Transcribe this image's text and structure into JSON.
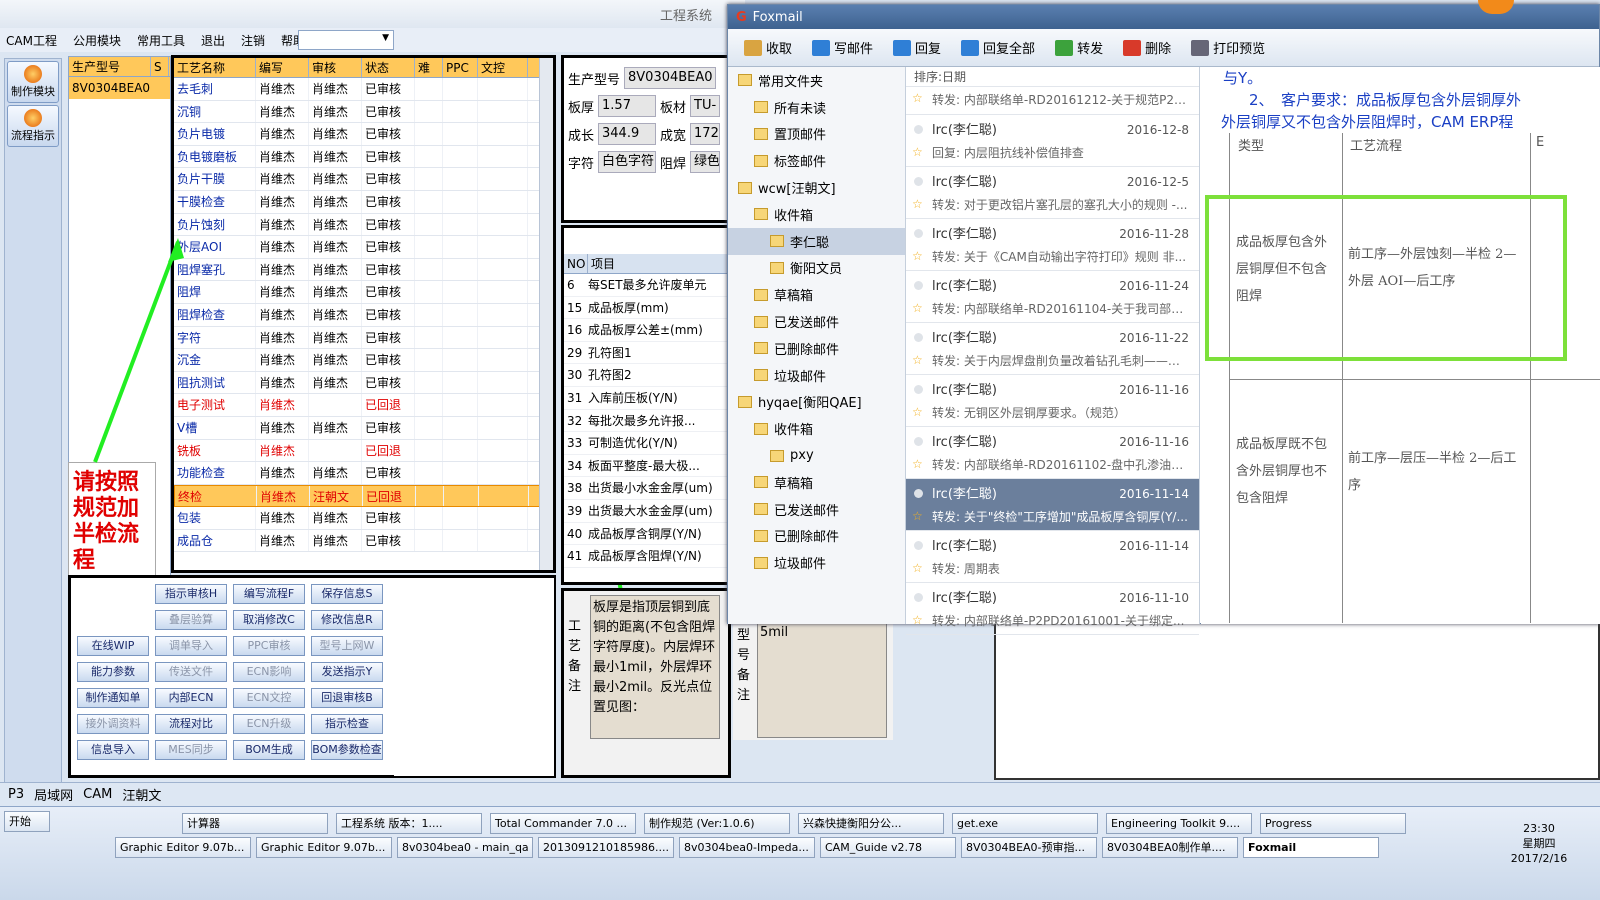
{
  "app": {
    "title": "工程系统",
    "menu": [
      "CAM工程",
      "公用模块",
      "常用工具",
      "退出",
      "注销",
      "帮助"
    ],
    "nav": [
      "制作模块",
      "流程指示"
    ]
  },
  "left_grid": {
    "headers": [
      "生产型号",
      "S"
    ],
    "value": "8V0304BEA0"
  },
  "process": {
    "headers": [
      "工艺名称",
      "编写",
      "审核",
      "状态",
      "难",
      "PPC",
      "文控"
    ],
    "rows": [
      [
        "去毛刺",
        "肖维杰",
        "肖维杰",
        "已审核"
      ],
      [
        "沉铜",
        "肖维杰",
        "肖维杰",
        "已审核"
      ],
      [
        "负片电镀",
        "肖维杰",
        "肖维杰",
        "已审核"
      ],
      [
        "负电镀磨板",
        "肖维杰",
        "肖维杰",
        "已审核"
      ],
      [
        "负片干膜",
        "肖维杰",
        "肖维杰",
        "已审核"
      ],
      [
        "干膜检查",
        "肖维杰",
        "肖维杰",
        "已审核"
      ],
      [
        "负片蚀刻",
        "肖维杰",
        "肖维杰",
        "已审核"
      ],
      [
        "外层AOI",
        "肖维杰",
        "肖维杰",
        "已审核"
      ],
      [
        "阻焊塞孔",
        "肖维杰",
        "肖维杰",
        "已审核"
      ],
      [
        "阻焊",
        "肖维杰",
        "肖维杰",
        "已审核"
      ],
      [
        "阻焊检查",
        "肖维杰",
        "肖维杰",
        "已审核"
      ],
      [
        "字符",
        "肖维杰",
        "肖维杰",
        "已审核"
      ],
      [
        "沉金",
        "肖维杰",
        "肖维杰",
        "已审核"
      ],
      [
        "阻抗测试",
        "肖维杰",
        "肖维杰",
        "已审核"
      ],
      [
        "电子测试",
        "肖维杰",
        "",
        "已回退"
      ],
      [
        "V槽",
        "肖维杰",
        "肖维杰",
        "已审核"
      ],
      [
        "铣板",
        "肖维杰",
        "",
        "已回退"
      ],
      [
        "功能检查",
        "肖维杰",
        "肖维杰",
        "已审核"
      ],
      [
        "终检",
        "肖维杰",
        "汪朝文",
        "已回退"
      ],
      [
        "包装",
        "肖维杰",
        "肖维杰",
        "已审核"
      ],
      [
        "成品仓",
        "肖维杰",
        "肖维杰",
        "已审核"
      ]
    ]
  },
  "note": "请按照规范加半检流程",
  "buttons": [
    [
      "指示审核H",
      "编写流程F",
      "保存信息S"
    ],
    [
      "叠层验算",
      "取消修改C",
      "修改信息R"
    ],
    [
      "在线WIP",
      "调单导入",
      "PPC审核",
      "型号上网W"
    ],
    [
      "能力参数",
      "传送文件",
      "ECN影响",
      "发送指示Y"
    ],
    [
      "制作通知单",
      "内部ECN",
      "ECN文控",
      "回退审核B"
    ],
    [
      "接外调资料",
      "流程对比",
      "ECN升级",
      "指示检查"
    ],
    [
      "信息导入",
      "MES同步",
      "BOM生成",
      "BOM参数检查"
    ]
  ],
  "info": {
    "model_label": "生产型号",
    "model": "8V0304BEA0",
    "thick_label": "板厚",
    "thick": "1.57",
    "mat_label": "板材",
    "mat": "TU-",
    "len_label": "成长",
    "len": "344.9",
    "wid_label": "成宽",
    "wid": "172",
    "char_label": "字符",
    "char": "白色字符",
    "mask_label": "阻焊",
    "mask": "绿色"
  },
  "params": {
    "headers": [
      "NO",
      "项目"
    ],
    "rows": [
      [
        "6",
        "每SET最多允许废单元"
      ],
      [
        "15",
        "成品板厚(mm)"
      ],
      [
        "16",
        "成品板厚公差±(mm)"
      ],
      [
        "29",
        "孔符图1"
      ],
      [
        "30",
        "孔符图2"
      ],
      [
        "31",
        "入库前压板(Y/N)"
      ],
      [
        "32",
        "每批次最多允许报..."
      ],
      [
        "33",
        "可制造优化(Y/N)"
      ],
      [
        "34",
        "板面平整度-最大极..."
      ],
      [
        "38",
        "出货最小水金金厚(um)"
      ],
      [
        "39",
        "出货最大水金金厚(um)"
      ],
      [
        "40",
        "成品板厚含铜厚(Y/N)"
      ],
      [
        "41",
        "成品板厚含阻焊(Y/N)"
      ]
    ]
  },
  "remark": {
    "label": "工艺备注",
    "text": "板厚是指顶层铜到底铜的距离(不包含阻焊字符厚度)。内层焊环最小1mil，外层焊环最小2mil。反光点位置见图：",
    "label2": "型号备注",
    "text2": "5mil"
  },
  "foxmail": {
    "title": "Foxmail",
    "toolbar": [
      "收取",
      "写邮件",
      "回复",
      "回复全部",
      "转发",
      "删除",
      "打印预览"
    ],
    "folders": [
      "常用文件夹",
      "所有未读",
      "置顶邮件",
      "标签邮件",
      "wcw[汪朝文]",
      "收件箱",
      "李仁聪",
      "衡阳文员",
      "草稿箱",
      "已发送邮件",
      "已删除邮件",
      "垃圾邮件",
      "hyqae[衡阳QAE]",
      "收件箱",
      "pxy",
      "草稿箱",
      "已发送邮件",
      "已删除邮件",
      "垃圾邮件"
    ],
    "sort": "排序:日期",
    "mails": [
      {
        "from": "",
        "date": "",
        "subj": "转发: 内部联络单-RD20161212-关于规范P2厂..."
      },
      {
        "from": "lrc(李仁聪)",
        "date": "2016-12-8",
        "subj": "回复: 内层阻抗线补偿值排查"
      },
      {
        "from": "lrc(李仁聪)",
        "date": "2016-12-5",
        "subj": "转发: 对于更改铝片塞孔层的塞孔大小的规则 -..."
      },
      {
        "from": "lrc(李仁聪)",
        "date": "2016-11-28",
        "subj": "转发: 关于《CAM自动输出字符打印》规则 非..."
      },
      {
        "from": "lrc(李仁聪)",
        "date": "2016-11-24",
        "subj": "转发: 内部联络单-RD20161104-关于我司部分..."
      },
      {
        "from": "lrc(李仁聪)",
        "date": "2016-11-22",
        "subj": "转发: 关于内层焊盘削负量改着钻孔毛刺——转..."
      },
      {
        "from": "lrc(李仁聪)",
        "date": "2016-11-16",
        "subj": "转发: 无铜区外层铜厚要求。（规范）"
      },
      {
        "from": "lrc(李仁聪)",
        "date": "2016-11-16",
        "subj": "转发: 内部联络单-RD20161102-盘中孔渗油改..."
      },
      {
        "from": "lrc(李仁聪)",
        "date": "2016-11-14",
        "subj": "转发: 关于\"终检\"工序增加\"成品板厚含铜厚(Y/..."
      },
      {
        "from": "lrc(李仁聪)",
        "date": "2016-11-14",
        "subj": "转发: 周期表"
      },
      {
        "from": "lrc(李仁聪)",
        "date": "2016-11-10",
        "subj": "转发: 内部联络单-P2PD20161001-关于绑定..."
      }
    ],
    "doc": {
      "line1": "与Y。",
      "line2": "2、　客户要求：成品板厚包含外层铜厚外",
      "line3": "外层铜厚又不包含外层阻焊时，CAM ERP程",
      "h1": "类型",
      "h2": "工艺流程",
      "h3": "E",
      "c1": "成品板厚包含外层铜厚但不包含阻焊",
      "c2": "前工序—外层蚀刻—半检 2—外层 AOI—后工序",
      "c3": "成品板厚既不包含外层铜厚也不包含阻焊",
      "c4": "前工序—层压—半检 2—后工序"
    }
  },
  "status": {
    "items": [
      "P3",
      "局域网",
      "CAM",
      "汪朝文"
    ]
  },
  "taskbar": {
    "start": "开始",
    "row1": [
      "计算器",
      "工程系统 版本：1....",
      "Total Commander 7.0 ...",
      "制作规范 (Ver:1.0.6)",
      "兴森快捷衡阳分公...",
      "get.exe",
      "Engineering Toolkit 9....",
      "Progress"
    ],
    "row2": [
      "Graphic Editor 9.07b...",
      "Graphic Editor 9.07b...",
      "8v0304bea0 - main_qa",
      "2013091210185986....",
      "8v0304bea0-Impeda...",
      "CAM_Guide v2.78",
      "8V0304BEA0-预审指...",
      "8V0304BEA0制作单....",
      "Foxmail"
    ],
    "time": "23:30",
    "day": "星期四",
    "date": "2017/2/16"
  }
}
